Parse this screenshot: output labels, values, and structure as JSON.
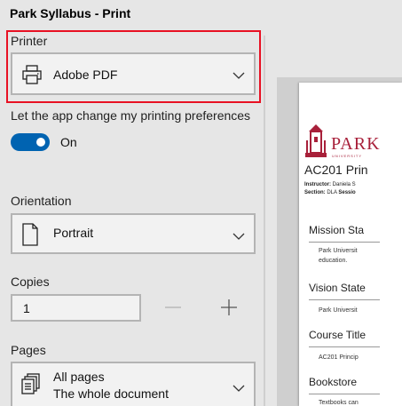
{
  "window": {
    "title": "Park Syllabus - Print"
  },
  "printer": {
    "label": "Printer",
    "value": "Adobe PDF"
  },
  "preferences": {
    "label": "Let the app change my printing preferences",
    "toggle_state": "On"
  },
  "orientation": {
    "label": "Orientation",
    "value": "Portrait"
  },
  "copies": {
    "label": "Copies",
    "value": "1"
  },
  "pages": {
    "label": "Pages",
    "value": "All pages",
    "description": "The whole document"
  },
  "preview": {
    "logo_text": "PARK",
    "logo_sub": "UNIVERSITY",
    "course": "AC201 Prin",
    "instructor_label": "Instructor:",
    "instructor_value": "Daniela S",
    "section_label": "Section:",
    "section_value": "DLA",
    "session_label": "Sessio",
    "sections": [
      {
        "heading": "Mission Sta",
        "text": "Park Universit",
        "text2": "education."
      },
      {
        "heading": "Vision State",
        "text": "Park Universit"
      },
      {
        "heading": "Course Title",
        "text": "AC201 Princip"
      },
      {
        "heading": "Bookstore",
        "text": "Textbooks can"
      }
    ]
  },
  "colors": {
    "accent": "#0063b1",
    "highlight": "#e81123",
    "brand": "#a8203a"
  }
}
